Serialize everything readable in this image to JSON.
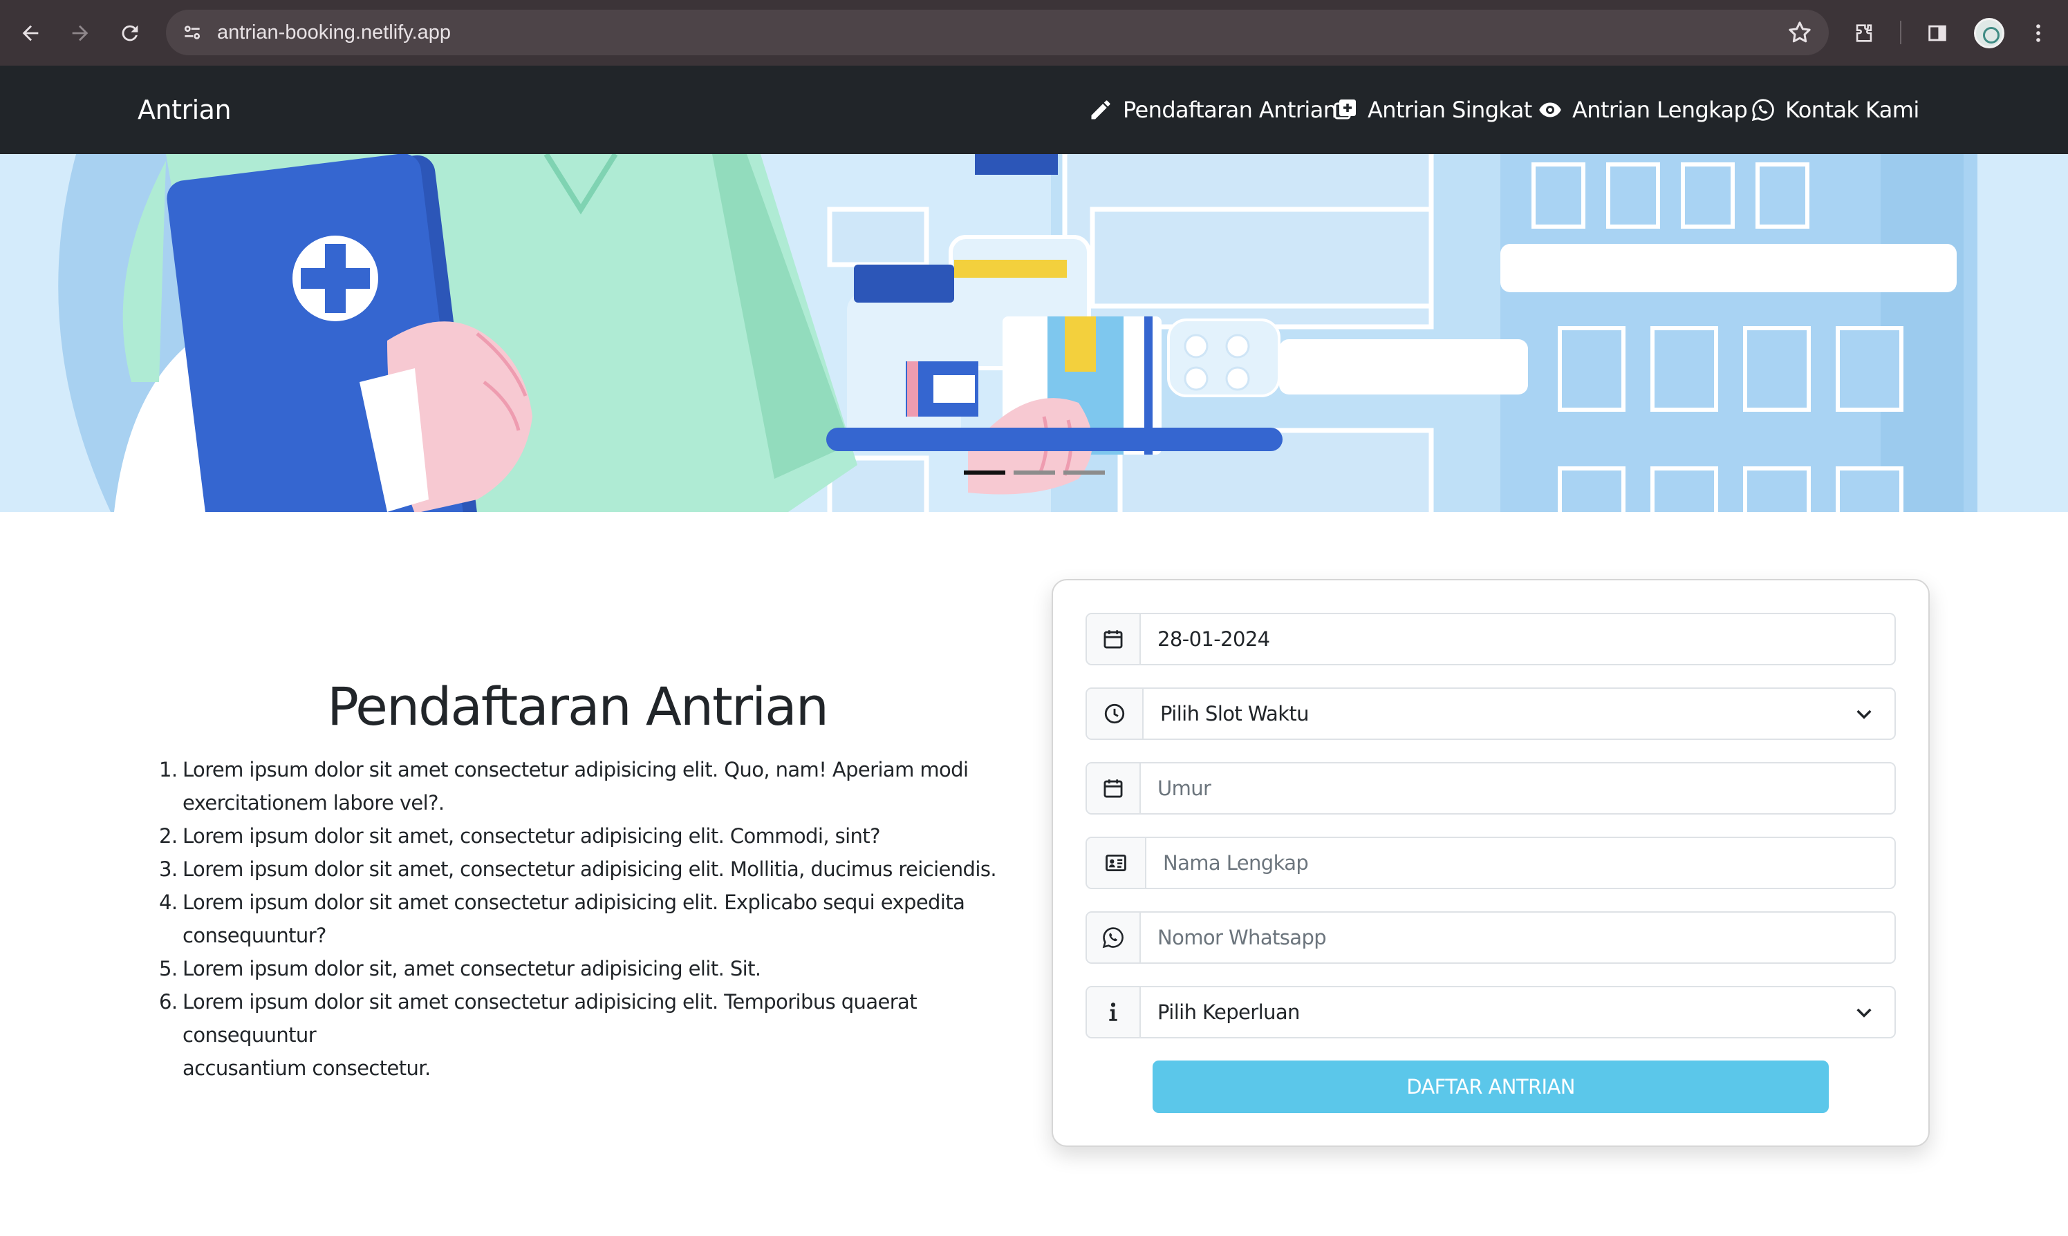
{
  "browser": {
    "url": "antrian-booking.netlify.app",
    "icons": [
      "back-arrow-icon",
      "forward-arrow-icon",
      "reload-icon",
      "site-settings-icon",
      "bookmark-star-icon",
      "extensions-icon",
      "side-panel-icon",
      "profile-avatar",
      "kebab-menu-icon"
    ]
  },
  "navbar": {
    "brand": "Antrian",
    "items": [
      {
        "label": "Pendaftaran Antrian",
        "icon": "pencil-icon"
      },
      {
        "label": "Antrian Singkat",
        "icon": "plus-square-icon"
      },
      {
        "label": "Antrian Lengkap",
        "icon": "eye-icon"
      },
      {
        "label": "Kontak Kami",
        "icon": "whatsapp-icon"
      }
    ]
  },
  "carousel": {
    "slides": 3,
    "active_slide": 1
  },
  "main": {
    "title": "Pendaftaran Antrian",
    "list": [
      {
        "num": "1.",
        "text": "Lorem ipsum dolor sit amet consectetur adipisicing elit. Quo, nam! Aperiam modi",
        "text2": "exercitationem labore vel?."
      },
      {
        "num": "2.",
        "text": "Lorem ipsum dolor sit amet, consectetur adipisicing elit. Commodi, sint?",
        "text2": ""
      },
      {
        "num": "3.",
        "text": "Lorem ipsum dolor sit amet, consectetur adipisicing elit. Mollitia, ducimus reiciendis.",
        "text2": ""
      },
      {
        "num": "4.",
        "text": "Lorem ipsum dolor sit amet consectetur adipisicing elit. Explicabo sequi expedita",
        "text2": "consequuntur?"
      },
      {
        "num": "5.",
        "text": "Lorem ipsum dolor sit, amet consectetur adipisicing elit. Sit.",
        "text2": ""
      },
      {
        "num": "6.",
        "text": "Lorem ipsum dolor sit amet consectetur adipisicing elit. Temporibus quaerat consequuntur",
        "text2": "accusantium consectetur."
      }
    ]
  },
  "form": {
    "date_value": "28-01-2024",
    "slot_label": "Pilih Slot Waktu",
    "age_placeholder": "Umur",
    "name_placeholder": "Nama Lengkap",
    "whatsapp_placeholder": "Nomor Whatsapp",
    "purpose_label": "Pilih Keperluan",
    "submit_label": "DAFTAR ANTRIAN"
  },
  "colors": {
    "navbar_bg": "#212529",
    "submit_bg": "#5bc7ea",
    "chrome_bg": "#3c3438"
  }
}
